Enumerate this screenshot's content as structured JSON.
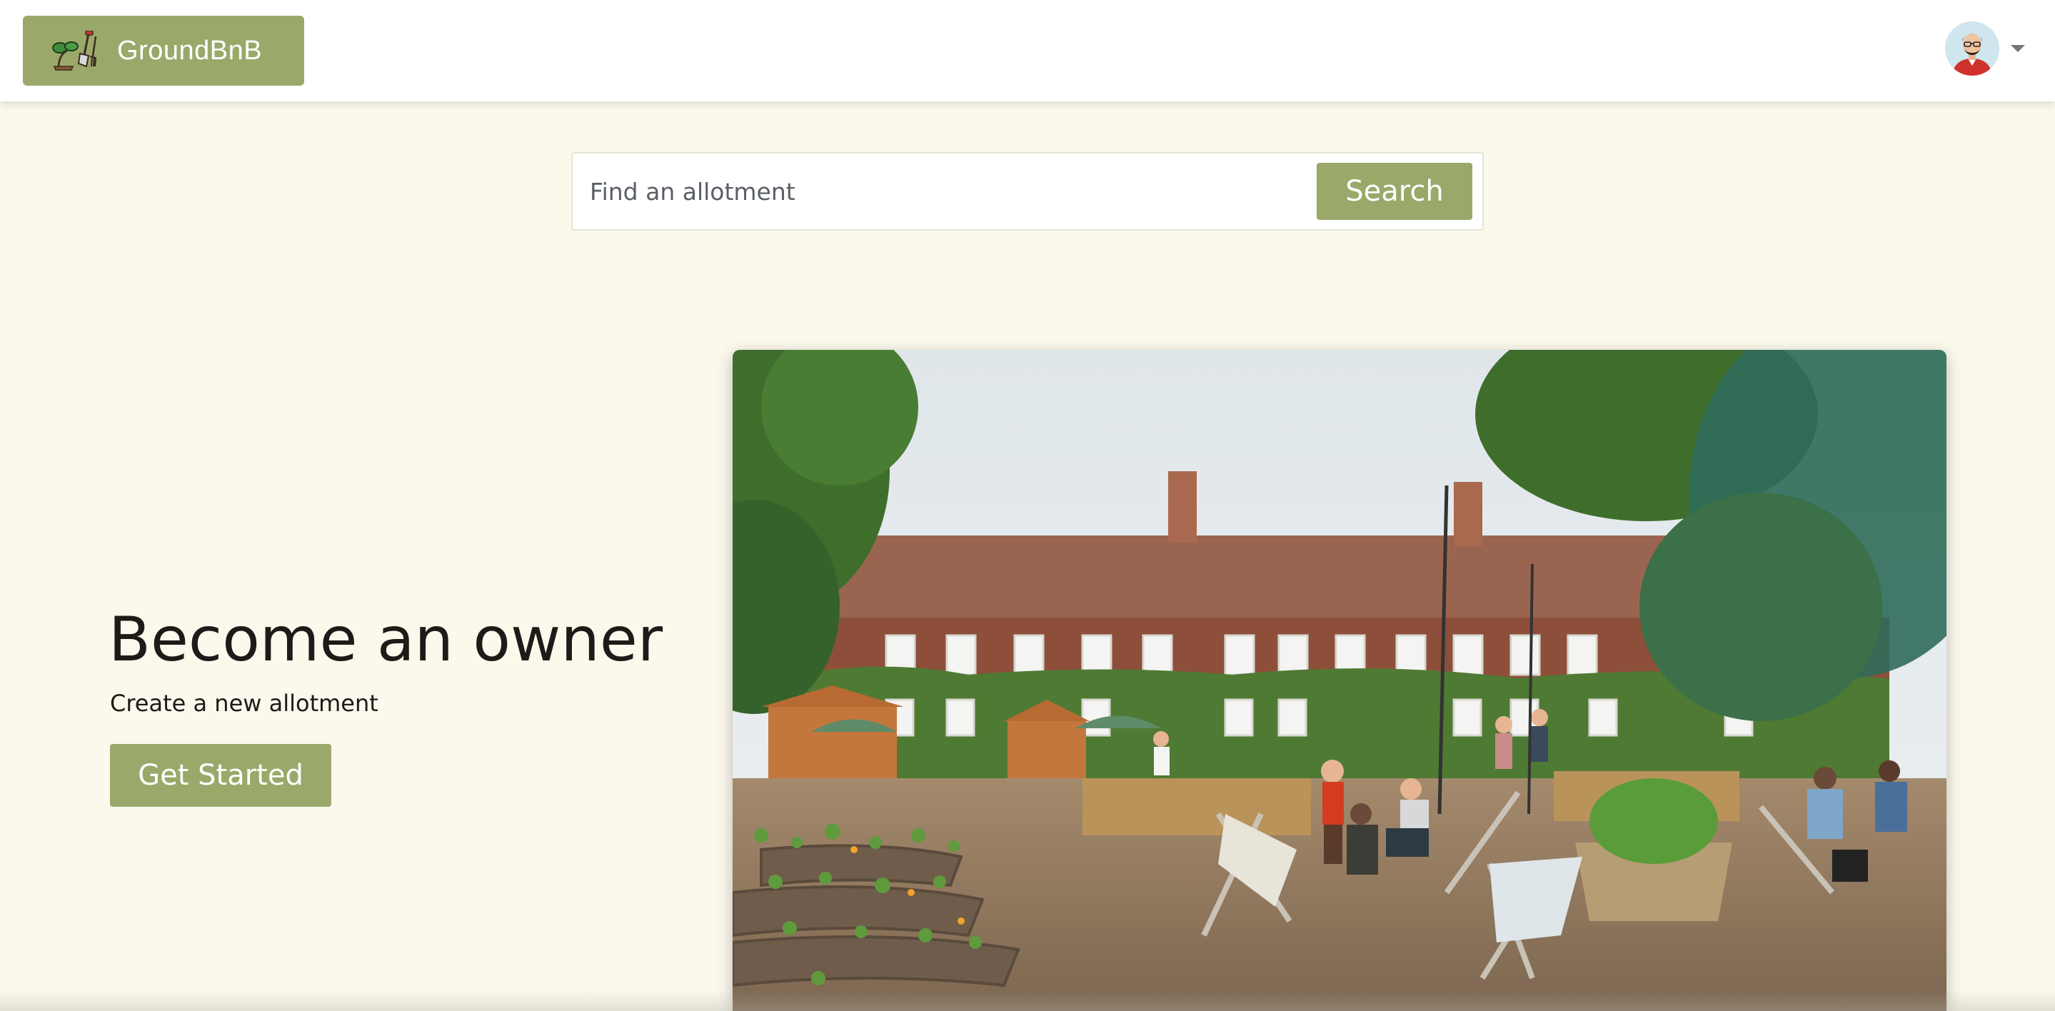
{
  "header": {
    "brand_name": "GroundBnB",
    "logo_icon": "gardening-tools-icon",
    "avatar_icon": "user-avatar-icon"
  },
  "search": {
    "placeholder": "Find an allotment",
    "value": "",
    "button_label": "Search"
  },
  "hero": {
    "title": "Become an owner",
    "subtitle": "Create a new allotment",
    "cta_label": "Get Started",
    "image_subject": "community-garden-photo"
  },
  "colors": {
    "accent": "#9aa96a",
    "page_background": "#fbf8ec",
    "header_background": "#ffffff",
    "text": "#1f1a17"
  }
}
